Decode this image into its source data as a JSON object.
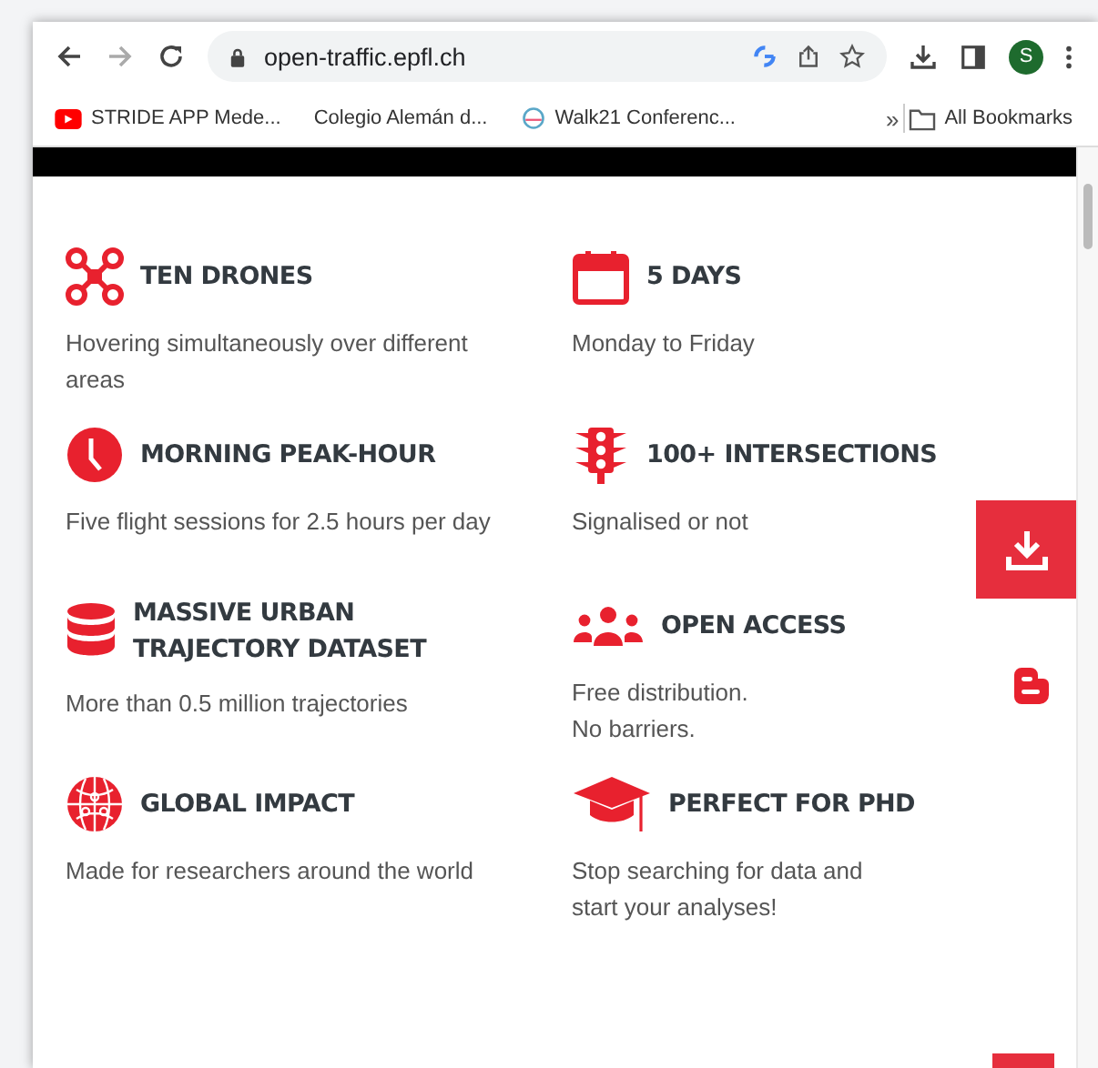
{
  "browser": {
    "address": "open-traffic.epfl.ch",
    "profile_initial": "S",
    "bookmarks": [
      {
        "label": "STRIDE APP Mede...",
        "kind": "video"
      },
      {
        "label": "Colegio Alemán d...",
        "kind": "plain"
      },
      {
        "label": "Walk21 Conferenc...",
        "kind": "logo"
      }
    ],
    "overflow": "»",
    "all_bookmarks": "All Bookmarks"
  },
  "features": [
    {
      "kind": "drones",
      "title": "TEN DRONES",
      "description": [
        "Hovering simultaneously over different areas"
      ]
    },
    {
      "kind": "calendar",
      "title": "5 DAYS",
      "description": [
        "Monday to Friday"
      ]
    },
    {
      "kind": "clock",
      "title": "MORNING PEAK-HOUR",
      "description": [
        "Five flight sessions for 2.5 hours per day"
      ]
    },
    {
      "kind": "traffic-light",
      "title": "100+ INTERSECTIONS",
      "description": [
        "Signalised or not"
      ]
    },
    {
      "kind": "database",
      "title": "MASSIVE URBAN TRAJECTORY DATASET",
      "description": [
        "More than 0.5 million trajectories"
      ]
    },
    {
      "kind": "people",
      "title": "OPEN ACCESS",
      "description": [
        "Free distribution.",
        "No barriers."
      ]
    },
    {
      "kind": "globe",
      "title": "GLOBAL IMPACT",
      "description": [
        "Made for researchers around the world"
      ]
    },
    {
      "kind": "cap",
      "title": "PERFECT FOR PHD",
      "description": [
        "Stop searching for data and",
        "start your analyses!"
      ]
    }
  ]
}
